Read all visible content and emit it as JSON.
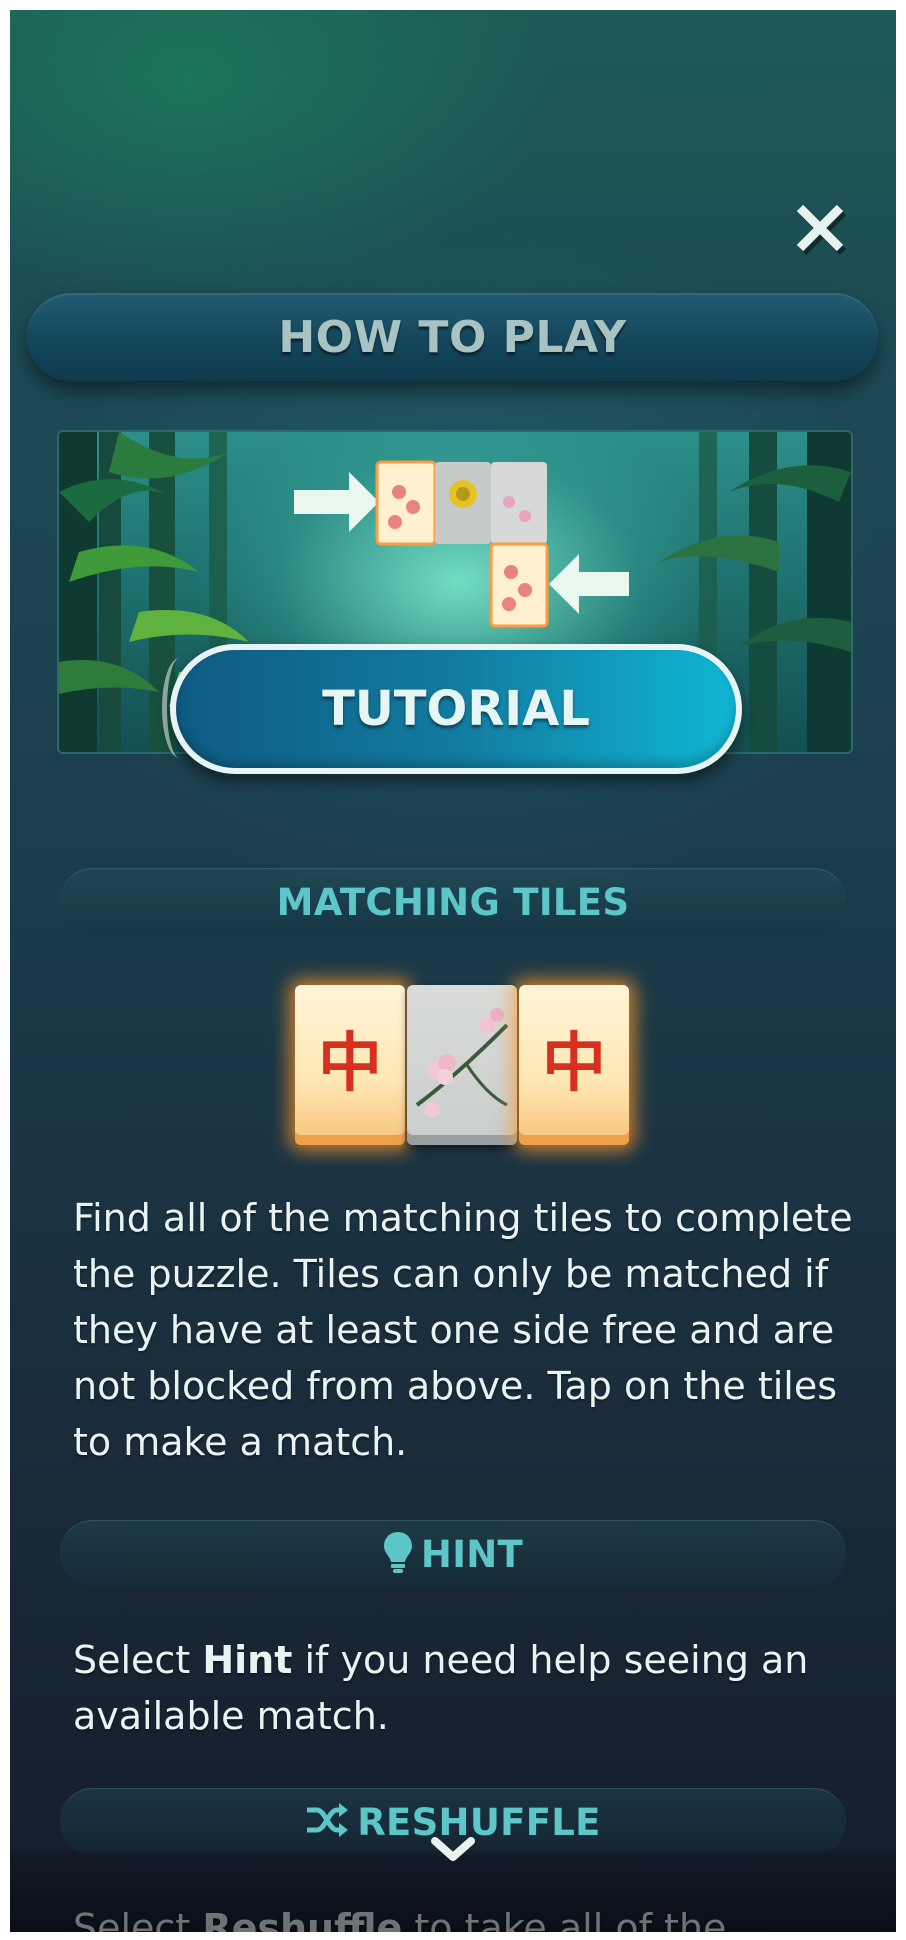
{
  "header": {
    "title": "HOW TO PLAY"
  },
  "tutorial": {
    "button_label": "TUTORIAL"
  },
  "sections": {
    "matching": {
      "title": "MATCHING TILES",
      "body": "Find all of the matching tiles to complete the puzzle. Tiles can only be matched if they have at least one side free and are not blocked from above. Tap on the tiles to make a match."
    },
    "hint": {
      "title": "HINT",
      "icon": "lightbulb-icon",
      "body_pre": "Select ",
      "body_bold": "Hint",
      "body_post": " if you need help seeing an available match."
    },
    "reshuffle": {
      "title": "RESHUFFLE",
      "icon": "shuffle-icon",
      "body_pre": "Select ",
      "body_bold": "Reshuffle",
      "body_post": " to take all of the"
    }
  },
  "tiles": {
    "red_character": "中"
  },
  "colors": {
    "accent": "#5cc6c8",
    "title_bar": "#14465b",
    "tutorial_button": "#127ba0",
    "tile_glow": "#ff9628"
  }
}
